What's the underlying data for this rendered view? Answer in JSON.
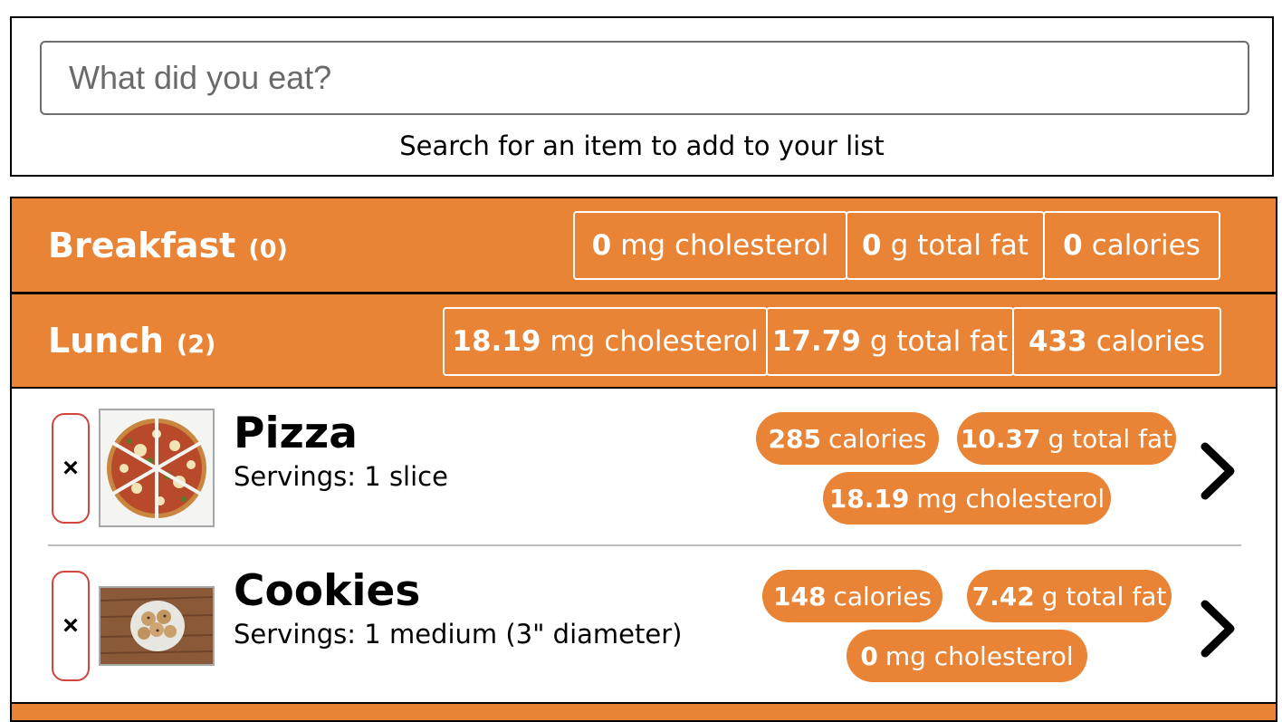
{
  "search": {
    "placeholder": "What did you eat?",
    "hint": "Search for an item to add to your list"
  },
  "meals": [
    {
      "name": "Breakfast",
      "count": "(0)",
      "stats": [
        {
          "value": "0",
          "label": "mg cholesterol"
        },
        {
          "value": "0",
          "label": "g total fat"
        },
        {
          "value": "0",
          "label": "calories"
        }
      ]
    },
    {
      "name": "Lunch",
      "count": "(2)",
      "stats": [
        {
          "value": "18.19",
          "label": "mg cholesterol"
        },
        {
          "value": "17.79",
          "label": "g total fat"
        },
        {
          "value": "433",
          "label": "calories"
        }
      ],
      "items": [
        {
          "name": "Pizza",
          "serving": "Servings: 1 slice",
          "remove_label": "×",
          "thumb_icon": "pizza-photo",
          "nutrients": [
            {
              "value": "285",
              "label": "calories"
            },
            {
              "value": "10.37",
              "label": "g total fat"
            },
            {
              "value": "18.19",
              "label": "mg cholesterol"
            }
          ]
        },
        {
          "name": "Cookies",
          "serving": "Servings: 1 medium (3\" diameter)",
          "remove_label": "×",
          "thumb_icon": "cookies-photo",
          "nutrients": [
            {
              "value": "148",
              "label": "calories"
            },
            {
              "value": "7.42",
              "label": "g total fat"
            },
            {
              "value": "0",
              "label": "mg cholesterol"
            }
          ]
        }
      ]
    }
  ],
  "colors": {
    "accent": "#e98436",
    "remove_border": "#d2443c"
  }
}
